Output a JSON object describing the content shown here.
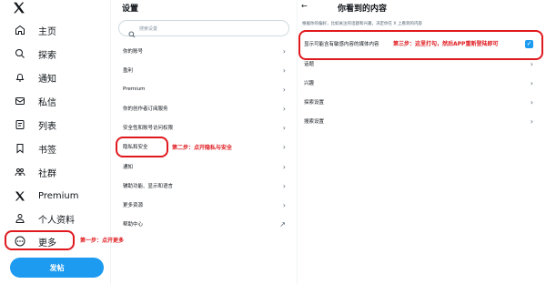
{
  "nav": {
    "logo": "x-logo-icon",
    "items": [
      {
        "label": "主页",
        "icon": "home-icon"
      },
      {
        "label": "探索",
        "icon": "search-icon"
      },
      {
        "label": "通知",
        "icon": "bell-icon"
      },
      {
        "label": "私信",
        "icon": "mail-icon"
      },
      {
        "label": "列表",
        "icon": "list-icon"
      },
      {
        "label": "书签",
        "icon": "bookmark-icon"
      },
      {
        "label": "社群",
        "icon": "community-icon"
      },
      {
        "label": "Premium",
        "icon": "x-premium-icon"
      },
      {
        "label": "个人资料",
        "icon": "person-icon"
      },
      {
        "label": "更多",
        "icon": "more-icon"
      }
    ],
    "post_label": "发帖"
  },
  "settings": {
    "title": "设置",
    "search_placeholder": "搜索设置",
    "items": [
      {
        "label": "你的账号",
        "arrow": "›"
      },
      {
        "label": "盈利",
        "arrow": "›"
      },
      {
        "label": "Premium",
        "arrow": "›"
      },
      {
        "label": "你的创作者订阅服务",
        "arrow": "›"
      },
      {
        "label": "安全性和账号访问权限",
        "arrow": "›"
      },
      {
        "label": "隐私和安全",
        "arrow": "›"
      },
      {
        "label": "通知",
        "arrow": "›"
      },
      {
        "label": "辅助功能、显示和语言",
        "arrow": "›"
      },
      {
        "label": "更多资源",
        "arrow": "›"
      },
      {
        "label": "帮助中心",
        "arrow": "↗"
      }
    ]
  },
  "content": {
    "back_icon": "←",
    "title": "你看到的内容",
    "description": "根据你的偏好，比如关注的话题和兴趣，决定你在 X 上看到的内容",
    "sensitive_label": "显示可能含有敏感内容的媒体内容",
    "sensitive_checked": true,
    "items": [
      {
        "label": "话题",
        "arrow": "›"
      },
      {
        "label": "兴趣",
        "arrow": "›"
      },
      {
        "label": "探索设置",
        "arrow": "›"
      },
      {
        "label": "搜索设置",
        "arrow": "›"
      }
    ]
  },
  "annotations": {
    "step1": "第一步：点开更多",
    "step2": "第二步：点开隐私与安全",
    "step3": "第三步：这里打勾，然后APP重新登陆即可"
  },
  "colors": {
    "accent": "#1d9bf0",
    "annotation": "#e0191e"
  }
}
